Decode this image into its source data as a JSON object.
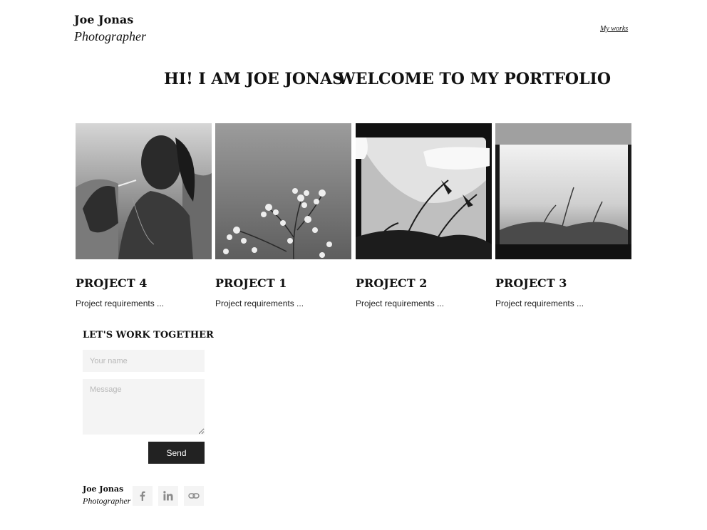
{
  "header": {
    "logo_name": "Joe Jonas",
    "logo_subtitle": "Photographer",
    "nav_link": "My works"
  },
  "hero": {
    "left": "HI! I AM JOE JONAS",
    "right": "WELCOME TO MY PORTFOLIO"
  },
  "projects": [
    {
      "title": "PROJECT 4",
      "description": "Project requirements ...",
      "image": "portrait-smoking-photo"
    },
    {
      "title": "PROJECT 1",
      "description": "Project requirements ...",
      "image": "white-flowers-photo"
    },
    {
      "title": "PROJECT 2",
      "description": "Project requirements ...",
      "image": "fern-film-photo"
    },
    {
      "title": "PROJECT 3",
      "description": "Project requirements ...",
      "image": "fern-fog-photo"
    }
  ],
  "contact": {
    "title": "LET'S WORK TOGETHER",
    "name_placeholder": "Your name",
    "message_placeholder": "Message",
    "send_label": "Send"
  },
  "footer": {
    "name": "Joe Jonas",
    "subtitle": "Photographer",
    "icons": [
      "facebook-icon",
      "linkedin-icon",
      "link-icon"
    ]
  }
}
